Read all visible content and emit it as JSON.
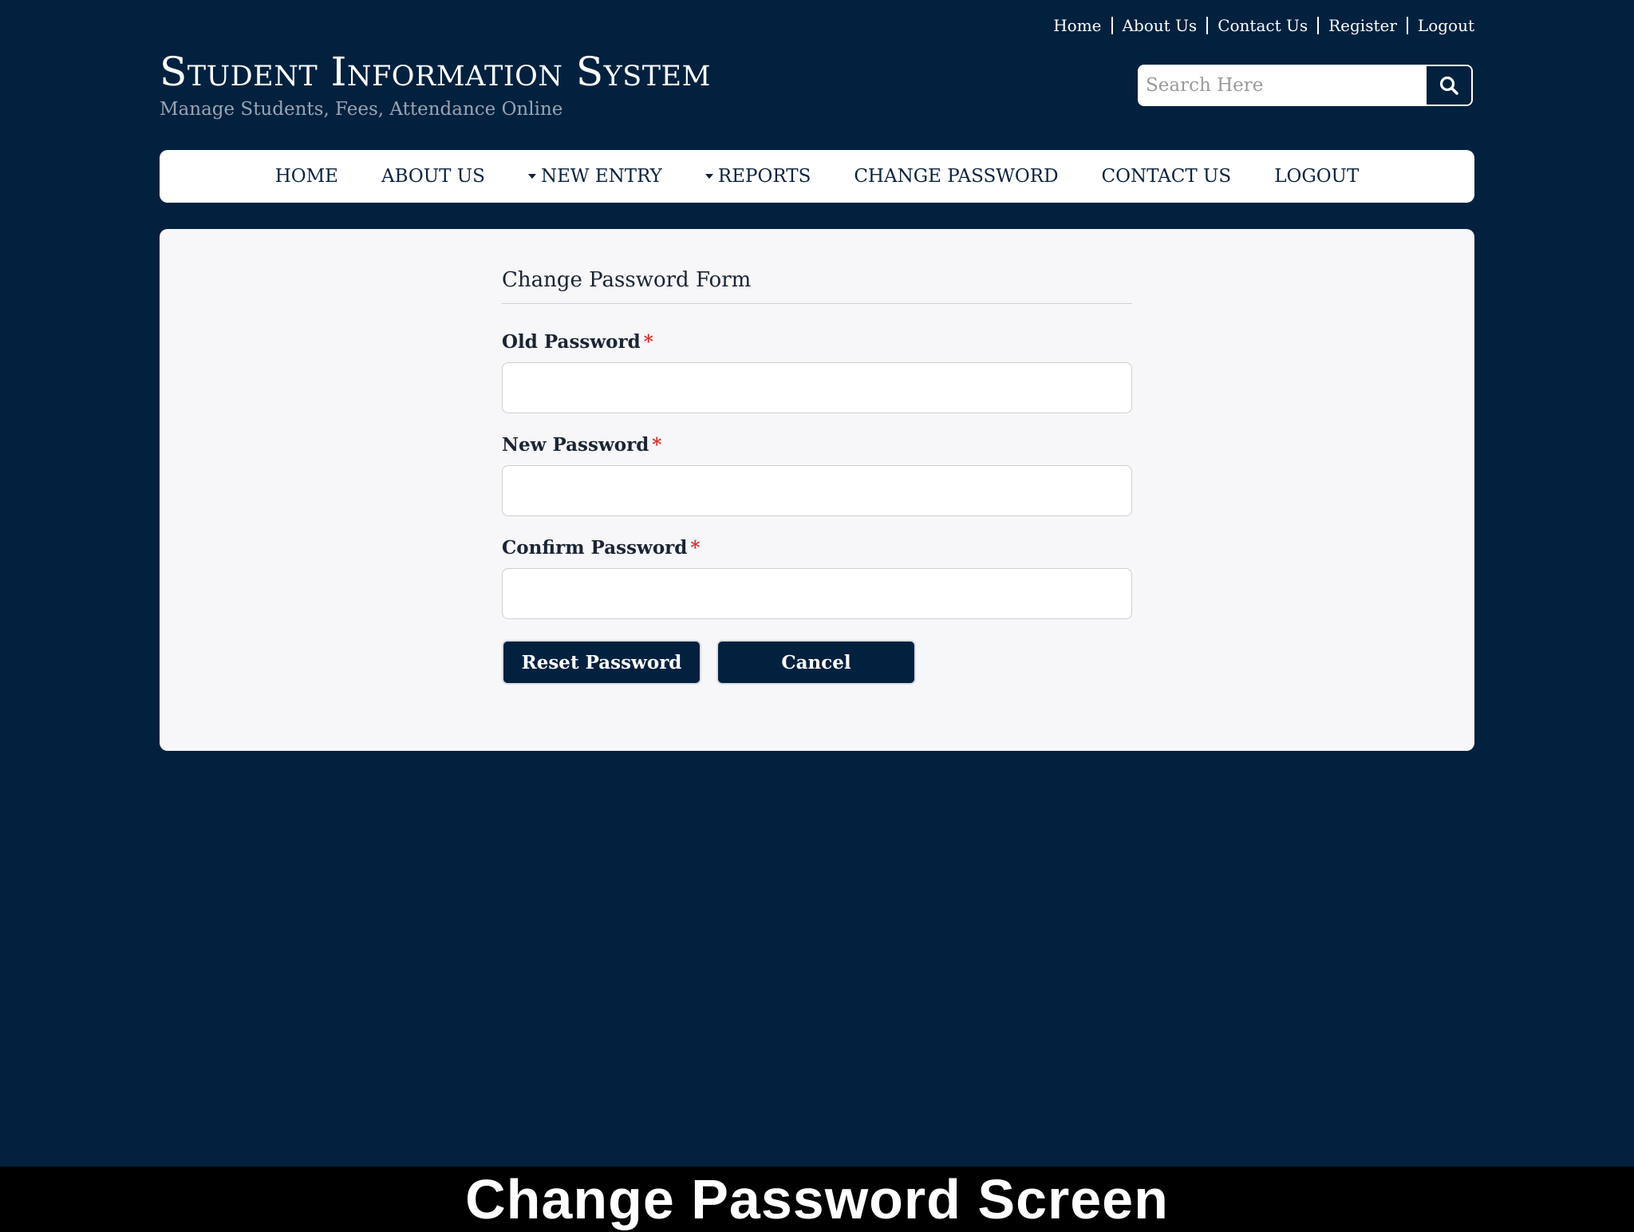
{
  "top_links": [
    "Home",
    "About Us",
    "Contact Us",
    "Register",
    "Logout"
  ],
  "brand": {
    "title": "Student Information System",
    "subtitle": "Manage Students, Fees, Attendance Online"
  },
  "search": {
    "placeholder": "Search Here",
    "icon": "search-icon"
  },
  "nav": [
    {
      "label": "HOME",
      "dropdown": false
    },
    {
      "label": "ABOUT US",
      "dropdown": false
    },
    {
      "label": "NEW ENTRY",
      "dropdown": true
    },
    {
      "label": "REPORTS",
      "dropdown": true
    },
    {
      "label": "CHANGE PASSWORD",
      "dropdown": false
    },
    {
      "label": "CONTACT US",
      "dropdown": false
    },
    {
      "label": "LOGOUT",
      "dropdown": false
    }
  ],
  "form": {
    "title": "Change Password Form",
    "fields": [
      {
        "label": "Old Password",
        "required_mark": "*",
        "value": ""
      },
      {
        "label": "New Password",
        "required_mark": "*",
        "value": ""
      },
      {
        "label": "Confirm Password",
        "required_mark": "*",
        "value": ""
      }
    ],
    "reset_label": "Reset Password",
    "cancel_label": "Cancel"
  },
  "caption": "Change Password Screen",
  "colors": {
    "page_bg": "#02213f",
    "card_bg": "#f7f6f8",
    "button_bg": "#02213f",
    "required": "#d0342c"
  }
}
